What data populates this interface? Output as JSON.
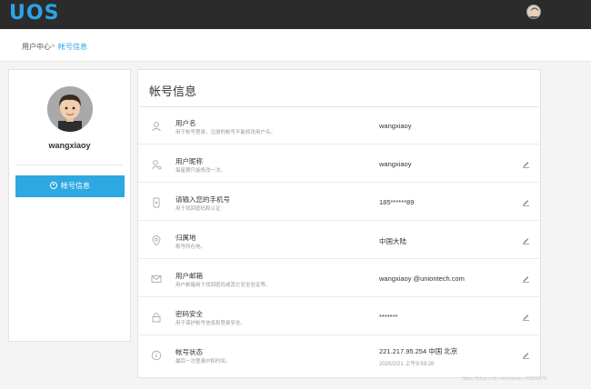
{
  "app": {
    "logo": "UOS"
  },
  "breadcrumb": {
    "home": "用户中心",
    "separator": ">",
    "current": "帐号信息"
  },
  "sidebar": {
    "username": "wangxiaoy",
    "menu_item": {
      "label": "帐号信息",
      "icon": "user-circle-icon"
    }
  },
  "main": {
    "title": "帐号信息",
    "rows": [
      {
        "label": "用户名",
        "desc": "用于帐号登录，注册的帐号不能修改用户名。",
        "value": "wangxiaoy",
        "icon": "user-icon",
        "editable": false
      },
      {
        "label": "用户昵称",
        "desc": "每星期只能修改一次。",
        "value": "wangxiaoy",
        "icon": "user-settings-icon",
        "editable": true
      },
      {
        "label": "请输入您的手机号",
        "desc": "用于找回密码和认证",
        "value": "185******89",
        "icon": "phone-icon",
        "editable": true
      },
      {
        "label": "归属地",
        "desc": "账号所在地。",
        "value": "中国大陆",
        "icon": "location-icon",
        "editable": true
      },
      {
        "label": "用户邮箱",
        "desc": "用户邮箱用于找回密码或其它安全验证等。",
        "value": "wangxiaoy  @uniontech.com",
        "icon": "mail-icon",
        "editable": true
      },
      {
        "label": "密码安全",
        "desc": "用于保护帐号信息和登录安全。",
        "value": "*******",
        "icon": "lock-icon",
        "editable": true
      },
      {
        "label": "帐号状态",
        "desc": "最后一次登录IP和时间。",
        "value": "221.217.95.254  中国 北京",
        "value2": "2020/2/21 上午9:59:28",
        "icon": "info-icon",
        "editable": true
      }
    ]
  },
  "watermark": "https://blog.csdn.net/weixin_43855876",
  "colors": {
    "accent": "#2aa4e6",
    "topbar": "#2b2b2b",
    "menu_active": "#2ea8e0"
  }
}
